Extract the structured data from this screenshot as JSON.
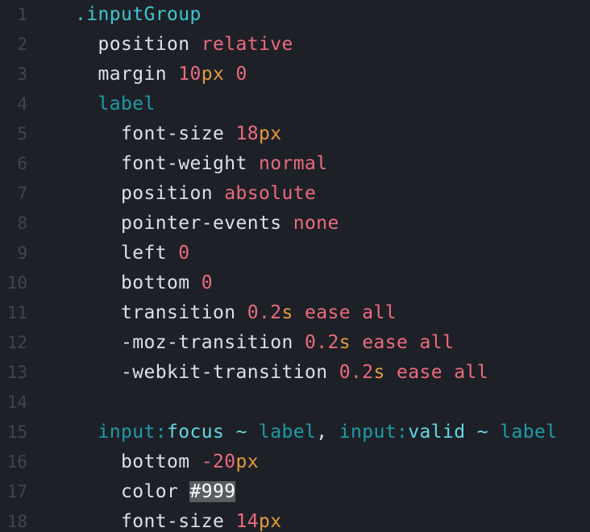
{
  "lines": [
    {
      "num": "1",
      "tokens": [
        {
          "t": ".inputGroup",
          "k": "sel"
        }
      ]
    },
    {
      "num": "2",
      "tokens": [
        {
          "t": "  position",
          "k": "prop"
        },
        {
          "t": " ",
          "k": "punc"
        },
        {
          "t": "relative",
          "k": "kw"
        }
      ]
    },
    {
      "num": "3",
      "tokens": [
        {
          "t": "  margin",
          "k": "prop"
        },
        {
          "t": " ",
          "k": "punc"
        },
        {
          "t": "10",
          "k": "num"
        },
        {
          "t": "px",
          "k": "unit"
        },
        {
          "t": " ",
          "k": "punc"
        },
        {
          "t": "0",
          "k": "num"
        }
      ]
    },
    {
      "num": "4",
      "tokens": [
        {
          "t": "  label",
          "k": "tag"
        }
      ]
    },
    {
      "num": "5",
      "tokens": [
        {
          "t": "    font-size",
          "k": "prop"
        },
        {
          "t": " ",
          "k": "punc"
        },
        {
          "t": "18",
          "k": "num"
        },
        {
          "t": "px",
          "k": "unit"
        }
      ]
    },
    {
      "num": "6",
      "tokens": [
        {
          "t": "    font-weight",
          "k": "prop"
        },
        {
          "t": " ",
          "k": "punc"
        },
        {
          "t": "normal",
          "k": "kw"
        }
      ]
    },
    {
      "num": "7",
      "tokens": [
        {
          "t": "    position",
          "k": "prop"
        },
        {
          "t": " ",
          "k": "punc"
        },
        {
          "t": "absolute",
          "k": "kw"
        }
      ]
    },
    {
      "num": "8",
      "tokens": [
        {
          "t": "    pointer-events",
          "k": "prop"
        },
        {
          "t": " ",
          "k": "punc"
        },
        {
          "t": "none",
          "k": "kw"
        }
      ]
    },
    {
      "num": "9",
      "tokens": [
        {
          "t": "    left",
          "k": "prop"
        },
        {
          "t": " ",
          "k": "punc"
        },
        {
          "t": "0",
          "k": "num"
        }
      ]
    },
    {
      "num": "10",
      "tokens": [
        {
          "t": "    bottom",
          "k": "prop"
        },
        {
          "t": " ",
          "k": "punc"
        },
        {
          "t": "0",
          "k": "num"
        }
      ]
    },
    {
      "num": "11",
      "tokens": [
        {
          "t": "    transition",
          "k": "prop"
        },
        {
          "t": " ",
          "k": "punc"
        },
        {
          "t": "0.2",
          "k": "num"
        },
        {
          "t": "s",
          "k": "unit"
        },
        {
          "t": " ",
          "k": "punc"
        },
        {
          "t": "ease",
          "k": "kw"
        },
        {
          "t": " ",
          "k": "punc"
        },
        {
          "t": "all",
          "k": "kw"
        }
      ]
    },
    {
      "num": "12",
      "tokens": [
        {
          "t": "    -moz-transition",
          "k": "prop"
        },
        {
          "t": " ",
          "k": "punc"
        },
        {
          "t": "0.2",
          "k": "num"
        },
        {
          "t": "s",
          "k": "unit"
        },
        {
          "t": " ",
          "k": "punc"
        },
        {
          "t": "ease",
          "k": "kw"
        },
        {
          "t": " ",
          "k": "punc"
        },
        {
          "t": "all",
          "k": "kw"
        }
      ]
    },
    {
      "num": "13",
      "tokens": [
        {
          "t": "    -webkit-transition",
          "k": "prop"
        },
        {
          "t": " ",
          "k": "punc"
        },
        {
          "t": "0.2",
          "k": "num"
        },
        {
          "t": "s",
          "k": "unit"
        },
        {
          "t": " ",
          "k": "punc"
        },
        {
          "t": "ease",
          "k": "kw"
        },
        {
          "t": " ",
          "k": "punc"
        },
        {
          "t": "all",
          "k": "kw"
        }
      ]
    },
    {
      "num": "14",
      "tokens": []
    },
    {
      "num": "15",
      "tokens": [
        {
          "t": "  input",
          "k": "tag"
        },
        {
          "t": ":",
          "k": "tag"
        },
        {
          "t": "focus",
          "k": "pseudo"
        },
        {
          "t": " ~ ",
          "k": "op"
        },
        {
          "t": "label",
          "k": "tag"
        },
        {
          "t": ", ",
          "k": "punc"
        },
        {
          "t": "input",
          "k": "tag"
        },
        {
          "t": ":",
          "k": "tag"
        },
        {
          "t": "valid",
          "k": "pseudo"
        },
        {
          "t": " ~ ",
          "k": "op"
        },
        {
          "t": "label",
          "k": "tag"
        }
      ]
    },
    {
      "num": "16",
      "tokens": [
        {
          "t": "    bottom",
          "k": "prop"
        },
        {
          "t": " ",
          "k": "punc"
        },
        {
          "t": "-20",
          "k": "num"
        },
        {
          "t": "px",
          "k": "unit"
        }
      ]
    },
    {
      "num": "17",
      "tokens": [
        {
          "t": "    color",
          "k": "prop"
        },
        {
          "t": " ",
          "k": "punc"
        },
        {
          "t": "#999",
          "k": "color"
        }
      ]
    },
    {
      "num": "18",
      "tokens": [
        {
          "t": "    font-size",
          "k": "prop"
        },
        {
          "t": " ",
          "k": "punc"
        },
        {
          "t": "14",
          "k": "num"
        },
        {
          "t": "px",
          "k": "unit"
        }
      ]
    }
  ]
}
